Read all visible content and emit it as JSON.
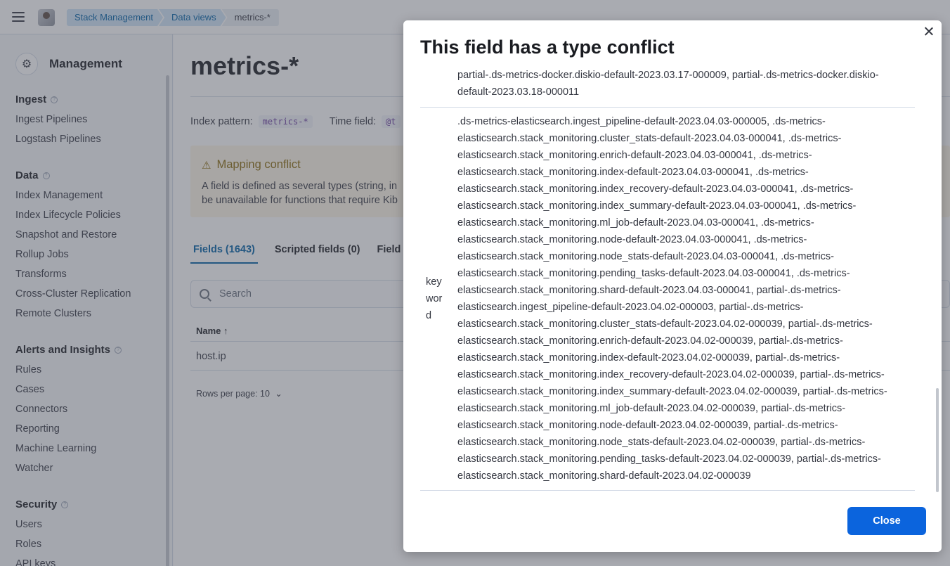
{
  "header": {
    "breadcrumbs": [
      "Stack Management",
      "Data views",
      "metrics-*"
    ]
  },
  "sidebar": {
    "title": "Management",
    "sections": [
      {
        "title": "Ingest",
        "items": [
          "Ingest Pipelines",
          "Logstash Pipelines"
        ]
      },
      {
        "title": "Data",
        "items": [
          "Index Management",
          "Index Lifecycle Policies",
          "Snapshot and Restore",
          "Rollup Jobs",
          "Transforms",
          "Cross-Cluster Replication",
          "Remote Clusters"
        ]
      },
      {
        "title": "Alerts and Insights",
        "items": [
          "Rules",
          "Cases",
          "Connectors",
          "Reporting",
          "Machine Learning",
          "Watcher"
        ]
      },
      {
        "title": "Security",
        "items": [
          "Users",
          "Roles",
          "API keys"
        ]
      }
    ]
  },
  "main": {
    "title": "metrics-*",
    "index_pattern_label": "Index pattern:",
    "index_pattern_value": "metrics-*",
    "time_field_label": "Time field:",
    "time_field_value": "@t",
    "callout_title": "Mapping conflict",
    "callout_body": "A field is defined as several types (string, in",
    "callout_body_2": "be unavailable for functions that require Kib",
    "tabs": [
      "Fields (1643)",
      "Scripted fields (0)",
      "Field"
    ],
    "search_placeholder": "Search",
    "table_header_name": "Name",
    "row_name": "host.ip",
    "rows_per_page": "Rows per page: 10"
  },
  "modal": {
    "title": "This field has a type conflict",
    "prev_indices": "partial-.ds-metrics-docker.diskio-default-2023.03.17-000009, partial-.ds-metrics-docker.diskio-default-2023.03.18-000011",
    "type": "keyword",
    "indices": ".ds-metrics-elasticsearch.ingest_pipeline-default-2023.04.03-000005, .ds-metrics-elasticsearch.stack_monitoring.cluster_stats-default-2023.04.03-000041, .ds-metrics-elasticsearch.stack_monitoring.enrich-default-2023.04.03-000041, .ds-metrics-elasticsearch.stack_monitoring.index-default-2023.04.03-000041, .ds-metrics-elasticsearch.stack_monitoring.index_recovery-default-2023.04.03-000041, .ds-metrics-elasticsearch.stack_monitoring.index_summary-default-2023.04.03-000041, .ds-metrics-elasticsearch.stack_monitoring.ml_job-default-2023.04.03-000041, .ds-metrics-elasticsearch.stack_monitoring.node-default-2023.04.03-000041, .ds-metrics-elasticsearch.stack_monitoring.node_stats-default-2023.04.03-000041, .ds-metrics-elasticsearch.stack_monitoring.pending_tasks-default-2023.04.03-000041, .ds-metrics-elasticsearch.stack_monitoring.shard-default-2023.04.03-000041, partial-.ds-metrics-elasticsearch.ingest_pipeline-default-2023.04.02-000003, partial-.ds-metrics-elasticsearch.stack_monitoring.cluster_stats-default-2023.04.02-000039, partial-.ds-metrics-elasticsearch.stack_monitoring.enrich-default-2023.04.02-000039, partial-.ds-metrics-elasticsearch.stack_monitoring.index-default-2023.04.02-000039, partial-.ds-metrics-elasticsearch.stack_monitoring.index_recovery-default-2023.04.02-000039, partial-.ds-metrics-elasticsearch.stack_monitoring.index_summary-default-2023.04.02-000039, partial-.ds-metrics-elasticsearch.stack_monitoring.ml_job-default-2023.04.02-000039, partial-.ds-metrics-elasticsearch.stack_monitoring.node-default-2023.04.02-000039, partial-.ds-metrics-elasticsearch.stack_monitoring.node_stats-default-2023.04.02-000039, partial-.ds-metrics-elasticsearch.stack_monitoring.pending_tasks-default-2023.04.02-000039, partial-.ds-metrics-elasticsearch.stack_monitoring.shard-default-2023.04.02-000039",
    "close_label": "Close"
  }
}
